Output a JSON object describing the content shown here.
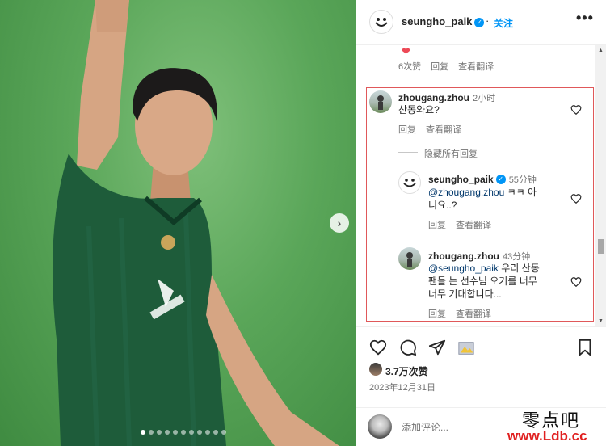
{
  "post": {
    "username": "seungho_paik",
    "follow_label": "关注",
    "more_label": "•••",
    "top_comment": {
      "likes": "6次赞",
      "reply_label": "回复",
      "translate_label": "查看翻译"
    },
    "comments": [
      {
        "username": "zhougang.zhou",
        "time": "2小时",
        "text": "산동와요?",
        "reply_label": "回复",
        "translate_label": "查看翻译",
        "hide_replies_label": "隐藏所有回复",
        "replies": [
          {
            "username": "seungho_paik",
            "time": "55分钟",
            "mention": "@zhougang.zhou",
            "text_line1": "ㅋㅋ 아",
            "text_line2": "니요..?",
            "reply_label": "回复",
            "translate_label": "查看翻译"
          },
          {
            "username": "zhougang.zhou",
            "time": "43分钟",
            "mention": "@seungho_paik",
            "text_line1": "우리 산동",
            "text_line2": "팬들 는 선수님 오기를 너무",
            "text_line3": "너무 기대합니다...",
            "reply_label": "回复",
            "translate_label": "查看翻译"
          }
        ]
      }
    ],
    "likes_count": "3.7万次赞",
    "date": "2023年12月31日",
    "add_comment_placeholder": "添加评论..."
  },
  "watermark": {
    "text": "零点吧",
    "url": "www.Ldb.cc"
  },
  "colors": {
    "accent": "#0095f6",
    "highlight_border": "#e0585a",
    "heart_red": "#ed4956",
    "jersey_green": "#1e5c3a"
  },
  "carousel": {
    "slides": 11,
    "active": 1
  }
}
